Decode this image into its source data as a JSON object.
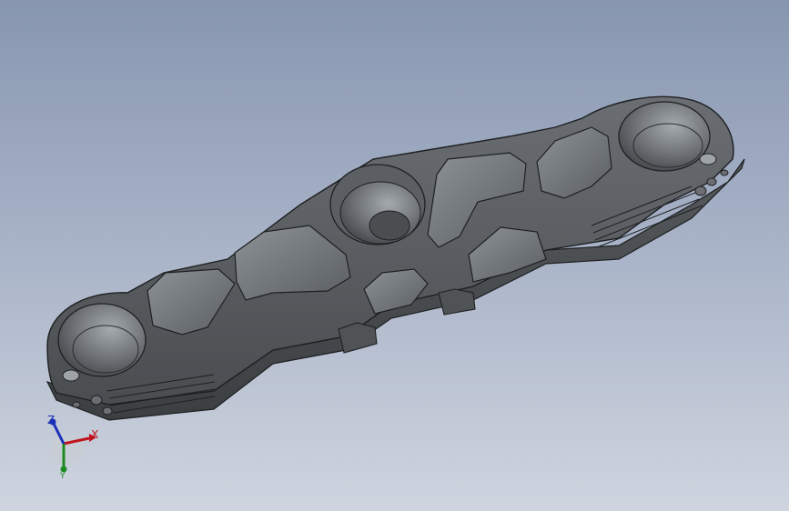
{
  "viewport": {
    "background_top": "#8796b0",
    "background_bottom": "#cfd5df",
    "part": {
      "name": "triple-clamp",
      "body_color": "#585c60",
      "edge_color": "#1e2022",
      "highlight_color": "#9ea3a7"
    }
  },
  "triad": {
    "x_label": "X",
    "y_label": "Y",
    "z_label": "Z",
    "x_color": "#c0141c",
    "y_color": "#1d8a22",
    "z_color": "#1c2fb8"
  }
}
